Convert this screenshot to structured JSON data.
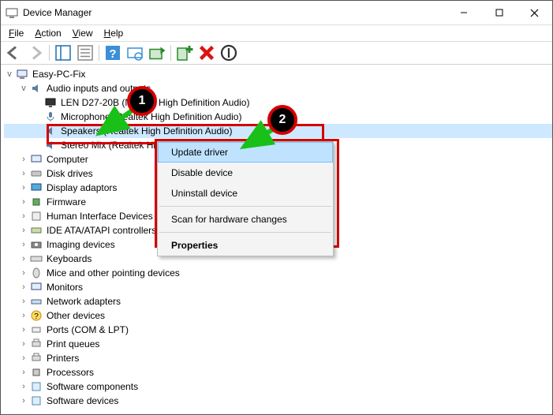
{
  "window": {
    "title": "Device Manager"
  },
  "menubar": {
    "file": "File",
    "action": "Action",
    "view": "View",
    "help": "Help"
  },
  "tree": {
    "root": "Easy-PC-Fix",
    "audio_category": "Audio inputs and outputs",
    "audio_children": {
      "lend27": "LEN D27-20B (NVIDIA High Definition Audio)",
      "microphone": "Microphone (Realtek High Definition Audio)",
      "speakers": "Speakers (Realtek High Definition Audio)",
      "stereomix": "Stereo Mix (Realtek High Definition Audio)"
    },
    "categories": [
      "Computer",
      "Disk drives",
      "Display adaptors",
      "Firmware",
      "Human Interface Devices",
      "IDE ATA/ATAPI controllers",
      "Imaging devices",
      "Keyboards",
      "Mice and other pointing devices",
      "Monitors",
      "Network adapters",
      "Other devices",
      "Ports (COM & LPT)",
      "Print queues",
      "Printers",
      "Processors",
      "Software components",
      "Software devices"
    ]
  },
  "context_menu": {
    "update": "Update driver",
    "disable": "Disable device",
    "uninstall": "Uninstall device",
    "scan": "Scan for hardware changes",
    "properties": "Properties"
  },
  "annotations": {
    "badge1": "1",
    "badge2": "2"
  },
  "icons": {
    "app": "device-manager",
    "back": "arrow-left",
    "forward": "arrow-right",
    "properties": "properties",
    "help": "help",
    "root": "computer-root"
  }
}
